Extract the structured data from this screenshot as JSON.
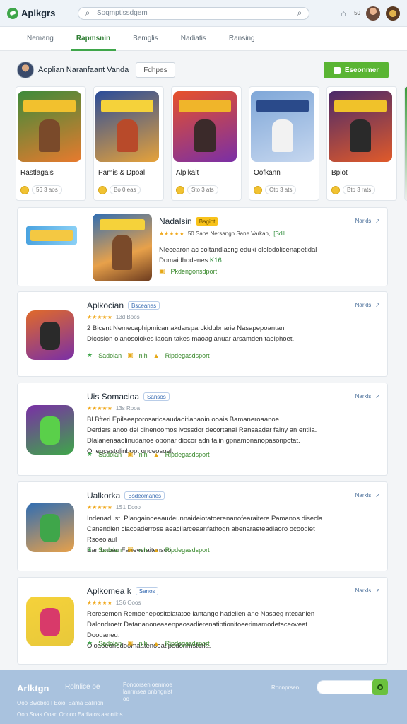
{
  "header": {
    "logo_text": "Aplkgrs",
    "search_placeholder": "Soqmptlssdgem",
    "notification_count": "50"
  },
  "tabs": [
    {
      "label": "Nemang"
    },
    {
      "label": "Rapmsnin"
    },
    {
      "label": "Bemglis"
    },
    {
      "label": "Nadiatis"
    },
    {
      "label": "Ransing"
    }
  ],
  "profile": {
    "name": "Aoplian Naranfaant Vanda",
    "follow_label": "Fdhpes",
    "install_label": "Eseonmer"
  },
  "carousel": [
    {
      "title": "Rastlagais",
      "meta": "56 3 aos",
      "banner": "#f2c12e",
      "bg1": "#3d8b3a",
      "bg2": "#e77a2e",
      "fig": "#7a4a2a"
    },
    {
      "title": "Pamis & Dpoal",
      "meta": "Bo 0 eas",
      "banner": "#f5d23a",
      "bg1": "#2a4c9a",
      "bg2": "#e6a23a",
      "fig": "#b84a2a"
    },
    {
      "title": "Alplkalt",
      "meta": "Sto 3 ats",
      "banner": "#f0b52a",
      "bg1": "#e7512a",
      "bg2": "#7a2fa6",
      "fig": "#3b2a2a"
    },
    {
      "title": "Oofkann",
      "meta": "Oto 3 ats",
      "banner": "#2a4a8a",
      "bg1": "#7fa7d8",
      "bg2": "#c6d7ef",
      "fig": "#f2f2f2"
    },
    {
      "title": "Bpiot",
      "meta": "Bto 3 rats",
      "banner": "#f0c22a",
      "bg1": "#4a2a6a",
      "bg2": "#e05a2a",
      "fig": "#2a2a2a"
    }
  ],
  "featured": {
    "name": "Nadalsin",
    "tag": "Bagiot",
    "rating_text": "50 Sans  Nersangn Sane Varkan,",
    "rating_tag": "[Sdil",
    "line1": "Nlecearon ac coltandlacng eduki ololodolicenapetidal",
    "line2_prefix": "Domaidhodenes",
    "line2_tag": "K16",
    "action": "Pkdengonsdport",
    "more": "Narkls"
  },
  "apps": [
    {
      "name": "Aplkocian",
      "tag": "Bsceanas",
      "rating": "13d Boos",
      "desc": [
        "2 Bicent Nemecaphipmican akdarsparckidubr arie Nasapepoantan",
        "Dlcosion olanosolokes laoan takes maoagianuar arsamden taoiphoet."
      ],
      "actions": [
        "Sadolan",
        "nih",
        "Ripdegasdsport"
      ],
      "more": "Narkls"
    },
    {
      "name": "Uis Somacioa",
      "tag": "Sansos",
      "rating": "13s Rooa",
      "desc": [
        "Bl Bfteri Epilaeaporosaricaaudaoitiahaoin ooais Bamaneroaanoe",
        "Derders anoo del dinenoomos ivossdor decortanal Ransaadar fainy an entlia.",
        "Dlalanenaaolinudanoe oponar diocor adn talin gpnamonanopasonpotat.",
        "Onegcastolinbopt onceosoel."
      ],
      "actions": [
        "Sadolan",
        "nih",
        "Ripdegasdsport"
      ],
      "more": "Narkls"
    },
    {
      "name": "Ualkorka",
      "tag": "Bsdeomanes",
      "rating": "1S1 Dcoo",
      "desc": [
        "Indenadust. Plangainoeaaudeunnaideiotatoerenanofearaitere Pamanos disecla",
        "Canendien clacoaderrose aeacllarceaanfathogn abenaraeteadiaoro ocoodiet",
        "Rsoeoiaul",
        "Eambnoan Faneveraitensoo."
      ],
      "actions": [
        "Sadolan",
        "nih",
        "Ripdegasdsport"
      ],
      "more": "Narkls"
    },
    {
      "name": "Aplkomea k",
      "tag": "Sanos",
      "rating": "1S6 Ooos",
      "desc": [
        "Reresemon Remoenepositeiatatoe lantange hadellen ane Nasaeg ntecanlen",
        "Dalondroetr Datananoneaaenpaosadierenatiptionitoeerimamodetaceoveat",
        "Doodaneu.",
        "Oloaoeonedoomaatenooatipedonrnstorla."
      ],
      "actions": [
        "Sadolan",
        "nih",
        "Ripdegasdsport"
      ],
      "more": "Narkls"
    }
  ],
  "footer": {
    "logo": "Arlktgn",
    "link1": "Rolnlice oe",
    "link2": "Ponoorsen oenmoe lanrmsea onbngnlst oo",
    "search_label": "Ronnprsen",
    "line1": "Ooo Bwobos   I Eoioi Eama Ealirion",
    "line2": "Ooo Soas Ooan Ooono Eadiatos aaontios"
  },
  "colors": {
    "accent": "#3fa64a",
    "install": "#5ab534",
    "footer": "#a9c2de",
    "link": "#3a6db3"
  }
}
